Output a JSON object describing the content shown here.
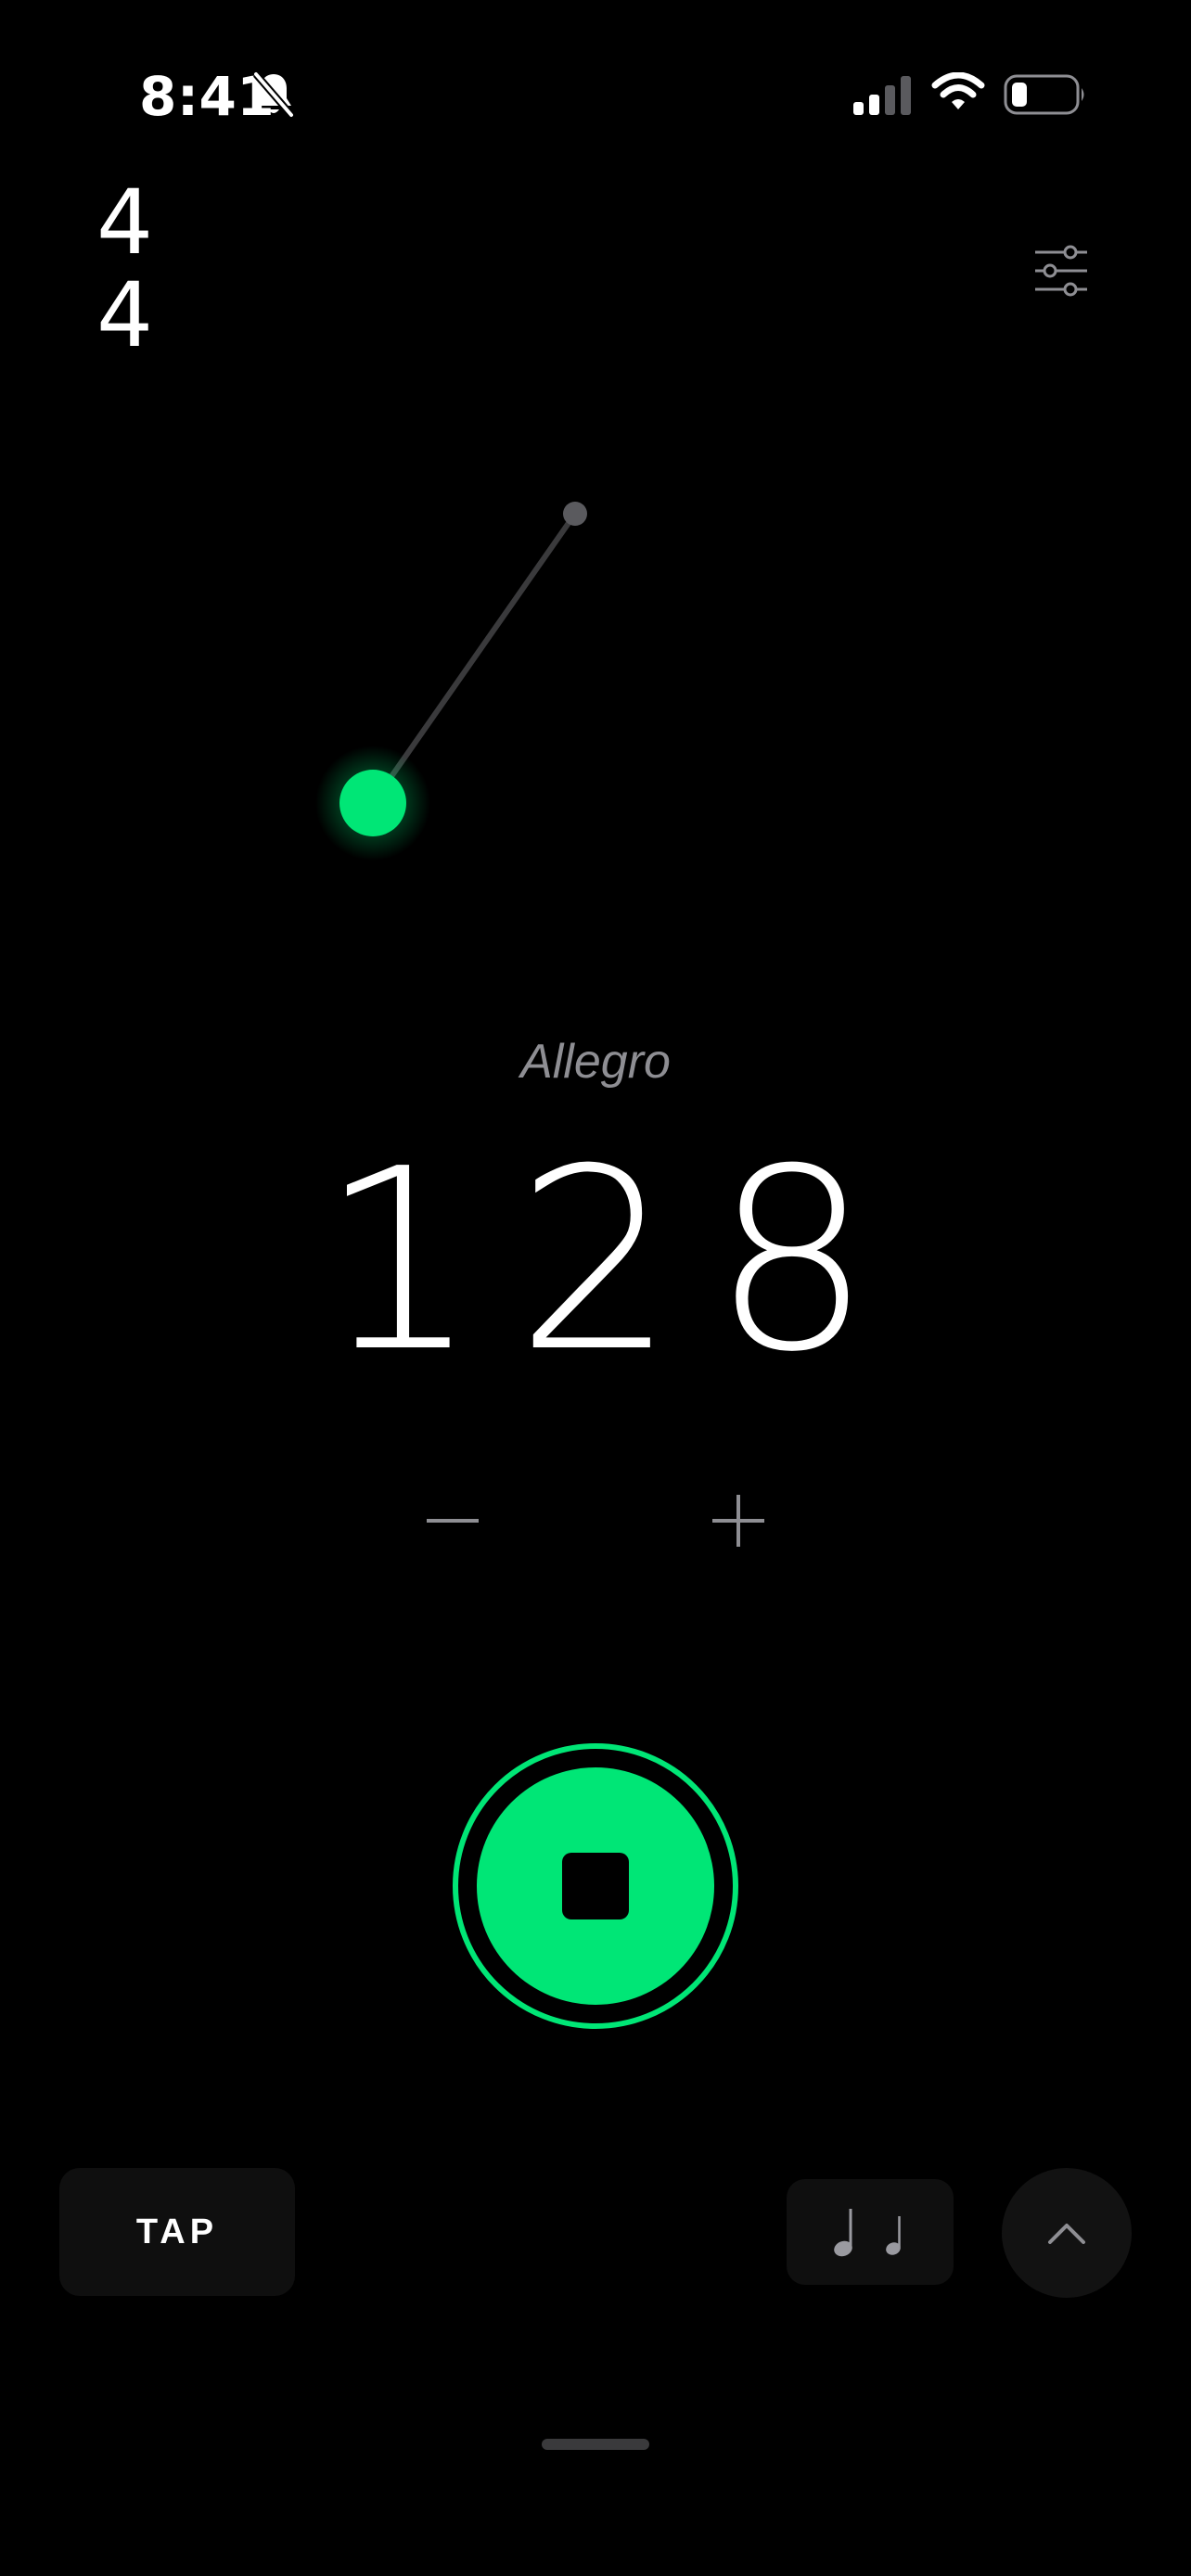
{
  "status_bar": {
    "time": "8:41",
    "icons": [
      "bell-slash-icon",
      "cellular-signal-icon",
      "wifi-icon",
      "battery-icon"
    ]
  },
  "time_signature": {
    "beats": "4",
    "note_value": "4"
  },
  "toolbar": {
    "settings_icon": "sliders-icon"
  },
  "tempo": {
    "name": "Allegro",
    "bpm": "128",
    "decrement_icon": "minus-icon",
    "increment_icon": "plus-icon"
  },
  "transport": {
    "state_icon": "stop-icon"
  },
  "controls": {
    "tap_label": "TAP",
    "subdivision_icons": [
      "quarter-note-icon",
      "quarter-note-icon"
    ],
    "expand_icon": "chevron-up-icon"
  },
  "colors": {
    "accent": "#00e676",
    "background": "#000000",
    "secondary_text": "#8e8e93",
    "button_surface": "#0f0f0f"
  }
}
